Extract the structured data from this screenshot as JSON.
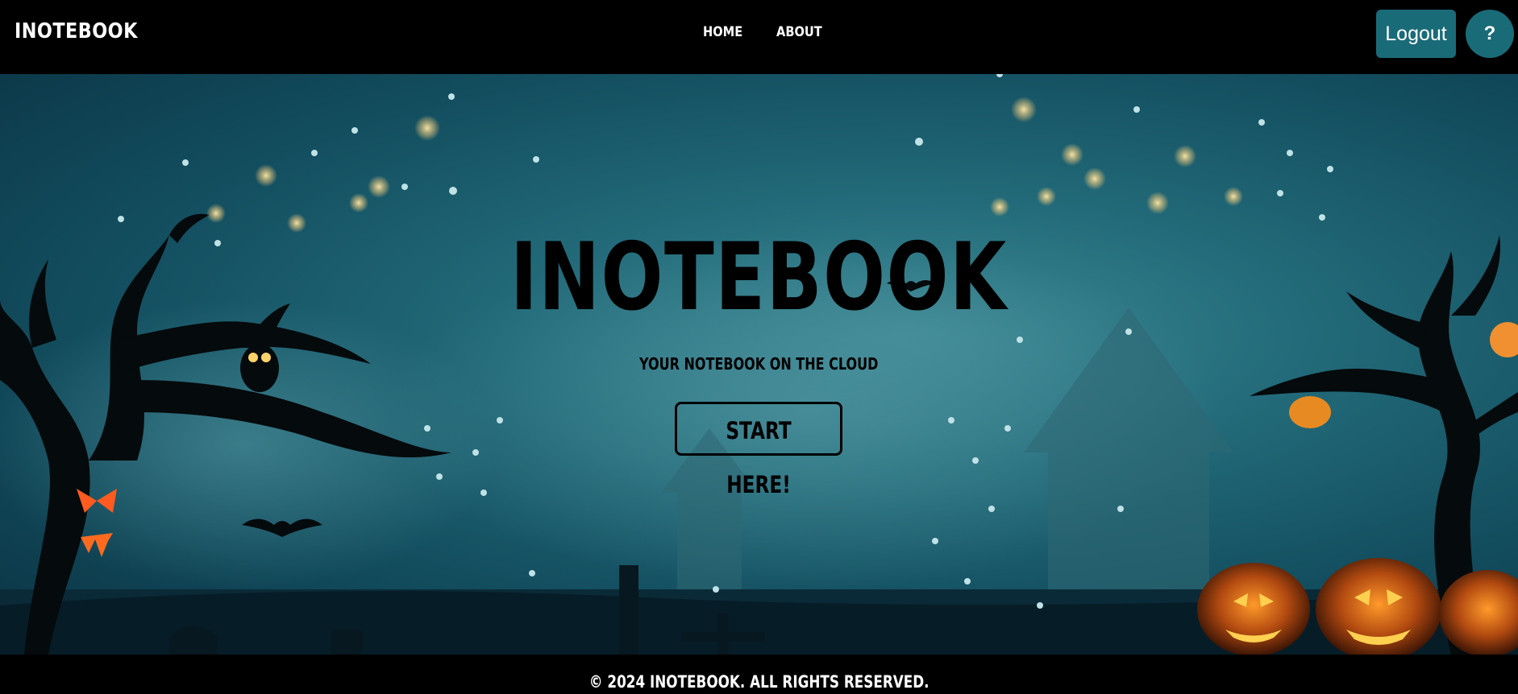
{
  "navbar": {
    "brand": "INOTEBOOK",
    "links": [
      {
        "label": "HOME"
      },
      {
        "label": "ABOUT"
      }
    ],
    "logout_label": "Logout",
    "help_label": "?"
  },
  "hero": {
    "title": "INOTEBOOK",
    "subtitle": "YOUR NOTEBOOK ON THE CLOUD",
    "cta_label": "START HERE!",
    "background_theme": "halloween-night-scene"
  },
  "footer": {
    "text": "© 2024 INOTEBOOK. ALL RIGHTS RESERVED."
  },
  "colors": {
    "navbar_bg": "#000000",
    "accent": "#1a6b78",
    "hero_sky": "#236b7a",
    "text_light": "#ffffff",
    "text_dark": "#000000"
  }
}
